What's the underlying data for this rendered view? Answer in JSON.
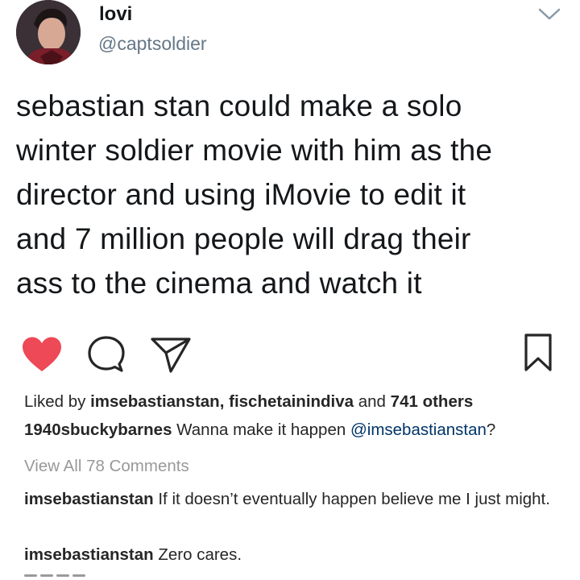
{
  "tweet": {
    "display_name": "lovi",
    "handle": "@captsoldier",
    "text_lines": [
      "sebastian stan could make a solo",
      "winter soldier movie with him as the",
      "director and using iMovie to edit it",
      "and 7 million people will drag their",
      "ass to the cinema and watch it"
    ]
  },
  "instagram": {
    "liked": true,
    "heart_color": "#ed4956",
    "likes": {
      "prefix": "Liked by ",
      "user1": "imsebastianstan",
      "separator": ", ",
      "user2": "fischetainindiva",
      "middle": " and ",
      "others": "741 others"
    },
    "caption": {
      "user": "1940sbuckybarnes",
      "text": " Wanna make it happen ",
      "mention": "@imsebastianstan",
      "suffix": "?"
    },
    "view_all_comments": "View All 78 Comments",
    "comments": [
      {
        "user": "imsebastianstan",
        "text": " If it doesn’t eventually happen believe me I just might."
      },
      {
        "user": "imsebastianstan",
        "text": " Zero cares."
      }
    ]
  },
  "icons": {
    "avatar": "profile-photo",
    "chevron": "chevron-down-icon",
    "heart": "heart-icon",
    "comment": "comment-icon",
    "share": "paper-plane-icon",
    "bookmark": "bookmark-icon"
  }
}
